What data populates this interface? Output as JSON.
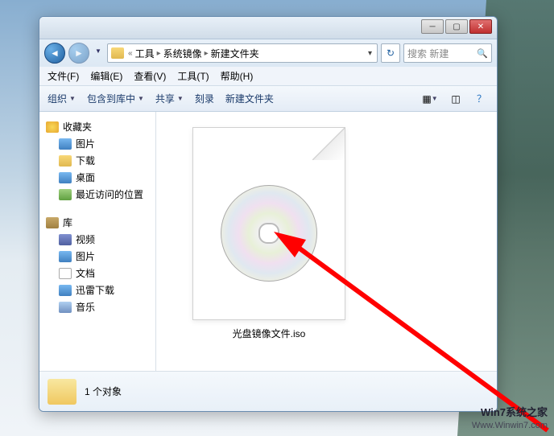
{
  "breadcrumb": {
    "sep_prefix": "«",
    "items": [
      "工具",
      "系统镜像",
      "新建文件夹"
    ]
  },
  "search": {
    "placeholder": "搜索 新建"
  },
  "menu": {
    "file": "文件(F)",
    "edit": "编辑(E)",
    "view": "查看(V)",
    "tools": "工具(T)",
    "help": "帮助(H)"
  },
  "toolbar": {
    "organize": "组织",
    "include": "包含到库中",
    "share": "共享",
    "burn": "刻录",
    "newfolder": "新建文件夹"
  },
  "sidebar": {
    "favorites": {
      "header": "收藏夹",
      "items": [
        "图片",
        "下载",
        "桌面",
        "最近访问的位置"
      ]
    },
    "libraries": {
      "header": "库",
      "items": [
        "视频",
        "图片",
        "文档",
        "迅雷下载",
        "音乐"
      ]
    }
  },
  "file": {
    "name": "光盘镜像文件.iso"
  },
  "status": {
    "count": "1 个对象"
  },
  "watermark": {
    "brand": "Win7系统之家",
    "url": "Www.Winwin7.com"
  }
}
